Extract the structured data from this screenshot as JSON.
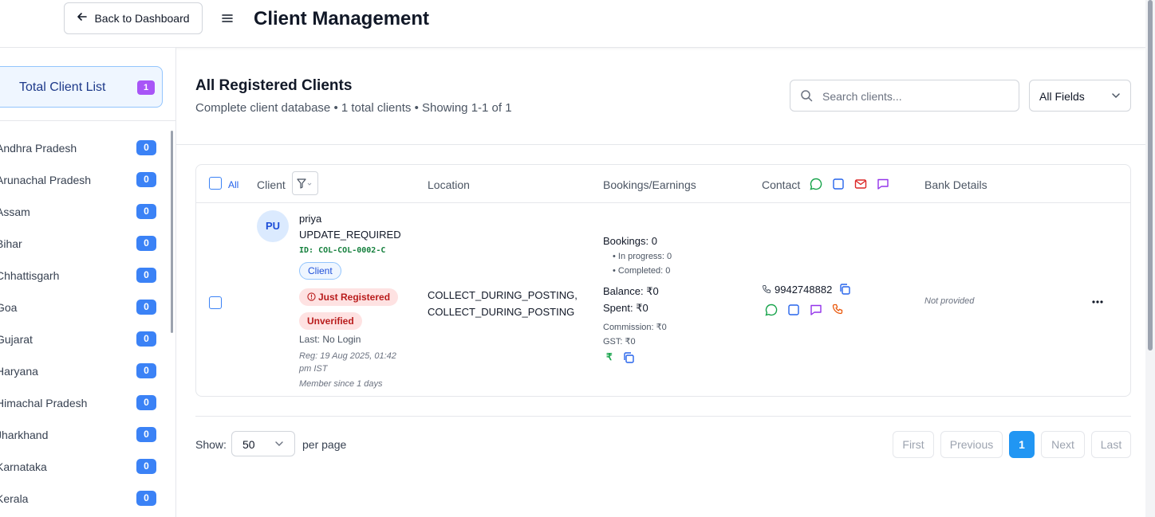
{
  "header": {
    "back_label": "Back to Dashboard",
    "title": "Client Management"
  },
  "sidebar": {
    "total": {
      "label": "Total Client List",
      "count": "1"
    },
    "states": [
      {
        "name": "Andhra Pradesh",
        "count": "0"
      },
      {
        "name": "Arunachal Pradesh",
        "count": "0"
      },
      {
        "name": "Assam",
        "count": "0"
      },
      {
        "name": "Bihar",
        "count": "0"
      },
      {
        "name": "Chhattisgarh",
        "count": "0"
      },
      {
        "name": "Goa",
        "count": "0"
      },
      {
        "name": "Gujarat",
        "count": "0"
      },
      {
        "name": "Haryana",
        "count": "0"
      },
      {
        "name": "Himachal Pradesh",
        "count": "0"
      },
      {
        "name": "Jharkhand",
        "count": "0"
      },
      {
        "name": "Karnataka",
        "count": "0"
      },
      {
        "name": "Kerala",
        "count": "0"
      }
    ]
  },
  "main": {
    "title": "All Registered Clients",
    "subtitle": "Complete client database • 1 total clients • Showing 1-1 of 1",
    "search": {
      "placeholder": "Search clients...",
      "value": ""
    },
    "field_filter": "All Fields"
  },
  "table": {
    "columns": {
      "all": "All",
      "client": "Client",
      "location": "Location",
      "bookings": "Bookings/Earnings",
      "contact": "Contact",
      "bank": "Bank Details"
    },
    "rows": [
      {
        "initials": "PU",
        "name": "priya",
        "status": "UPDATE_REQUIRED",
        "id": "ID: COL-COL-0002-C",
        "role": "Client",
        "registration_badge": "Just Registered",
        "verification_badge": "Unverified",
        "last_login": "Last: No Login",
        "registered": "Reg: 19 Aug 2025, 01:42 pm IST",
        "member_since": "Member since 1 days",
        "location_line1": "COLLECT_DURING_POSTING,",
        "location_line2": "COLLECT_DURING_POSTING",
        "bookings": "Bookings: 0",
        "in_progress": "• In progress: 0",
        "completed": "• Completed: 0",
        "balance": "Balance: ₹0",
        "spent": "Spent: ₹0",
        "commission": "Commission: ₹0",
        "gst": "GST: ₹0",
        "phone": "9942748882",
        "bank": "Not provided"
      }
    ]
  },
  "pagination": {
    "show_label": "Show:",
    "per_page_value": "50",
    "per_page_label": "per page",
    "first": "First",
    "previous": "Previous",
    "current": "1",
    "next": "Next",
    "last": "Last"
  },
  "colors": {
    "primary": "#2196f3",
    "badge_purple": "#a855f7",
    "badge_blue": "#3b82f6",
    "danger_bg": "#fee2e2",
    "danger_text": "#b91c1c",
    "id_green": "#15803d"
  },
  "icons": {
    "back": "arrow-left-icon",
    "menu": "hamburger-icon",
    "search": "search-icon",
    "chevron": "chevron-down-icon",
    "filter": "filter-icon",
    "whatsapp": "message-circle-icon",
    "telegram": "square-icon",
    "email": "mail-icon",
    "sms": "message-square-icon",
    "call": "phone-icon",
    "copy": "copy-icon",
    "rupee": "rupee-icon",
    "more": "more-horizontal-icon"
  }
}
